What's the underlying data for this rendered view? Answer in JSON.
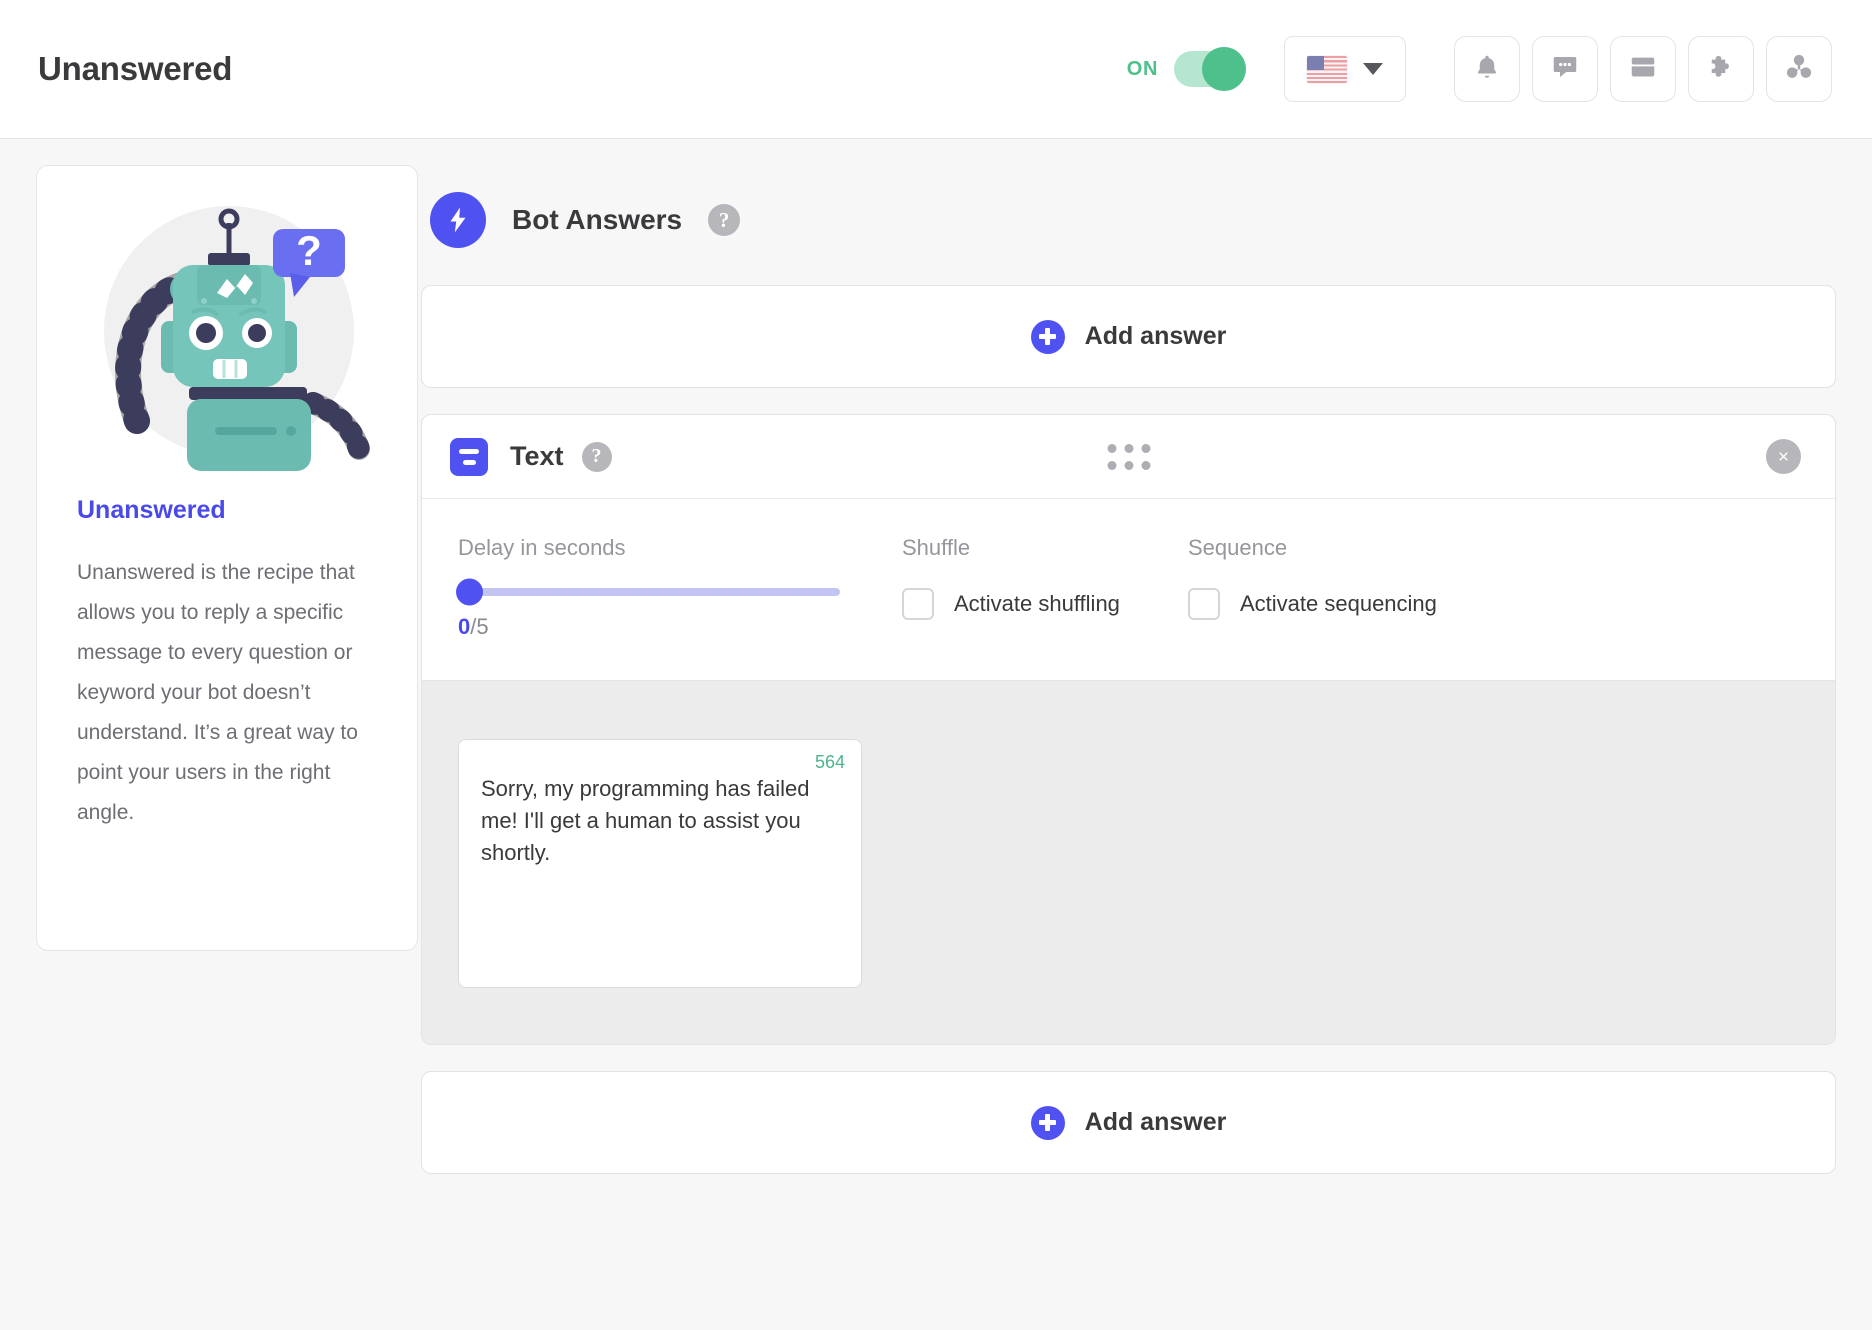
{
  "header": {
    "title": "Unanswered",
    "toggle": {
      "label": "ON",
      "state": "on",
      "color": "#4ec08c"
    },
    "language": {
      "flag": "us-flag-icon",
      "caret": "chevron-down-icon"
    },
    "icons": [
      {
        "name": "bell-icon",
        "label": "Notifications"
      },
      {
        "name": "chat-bubble-icon",
        "label": "Conversations"
      },
      {
        "name": "inbox-icon",
        "label": "Inbox"
      },
      {
        "name": "puzzle-piece-icon",
        "label": "Integrations"
      },
      {
        "name": "connections-icon",
        "label": "Connections"
      }
    ]
  },
  "sidebar": {
    "illustration": "robot-question-illustration",
    "recipe_title": "Unanswered",
    "recipe_description": "Unanswered is the recipe that allows you to reply a specific message to every question or keyword your bot doesn’t understand. It’s a great way to point your users in the right angle."
  },
  "main": {
    "section": {
      "icon": "lightning-bolt-icon",
      "title": "Bot Answers",
      "help": "?"
    },
    "add_answer_top": {
      "label": "Add answer",
      "icon": "plus-icon"
    },
    "add_answer_bottom": {
      "label": "Add answer",
      "icon": "plus-icon"
    },
    "text_block": {
      "icon": "text-lines-icon",
      "title": "Text",
      "help": "?",
      "drag_handle": "drag-dots-icon",
      "close": "close-icon",
      "delay": {
        "label": "Delay in seconds",
        "value": "0",
        "max": "/5",
        "max_number": 5,
        "current": 0
      },
      "shuffle": {
        "label": "Shuffle",
        "checkbox_label": "Activate shuffling",
        "checked": false
      },
      "sequence": {
        "label": "Sequence",
        "checkbox_label": "Activate sequencing",
        "checked": false
      },
      "message": {
        "value": "Sorry, my programming has failed me! I'll get a human to assist you shortly.",
        "char_count": "564"
      }
    }
  },
  "colors": {
    "accent": "#4f52f0",
    "accent_link": "#4a4aea",
    "toggle_on": "#4ec08c",
    "counter_green": "#4cb589",
    "muted": "#96969c"
  }
}
